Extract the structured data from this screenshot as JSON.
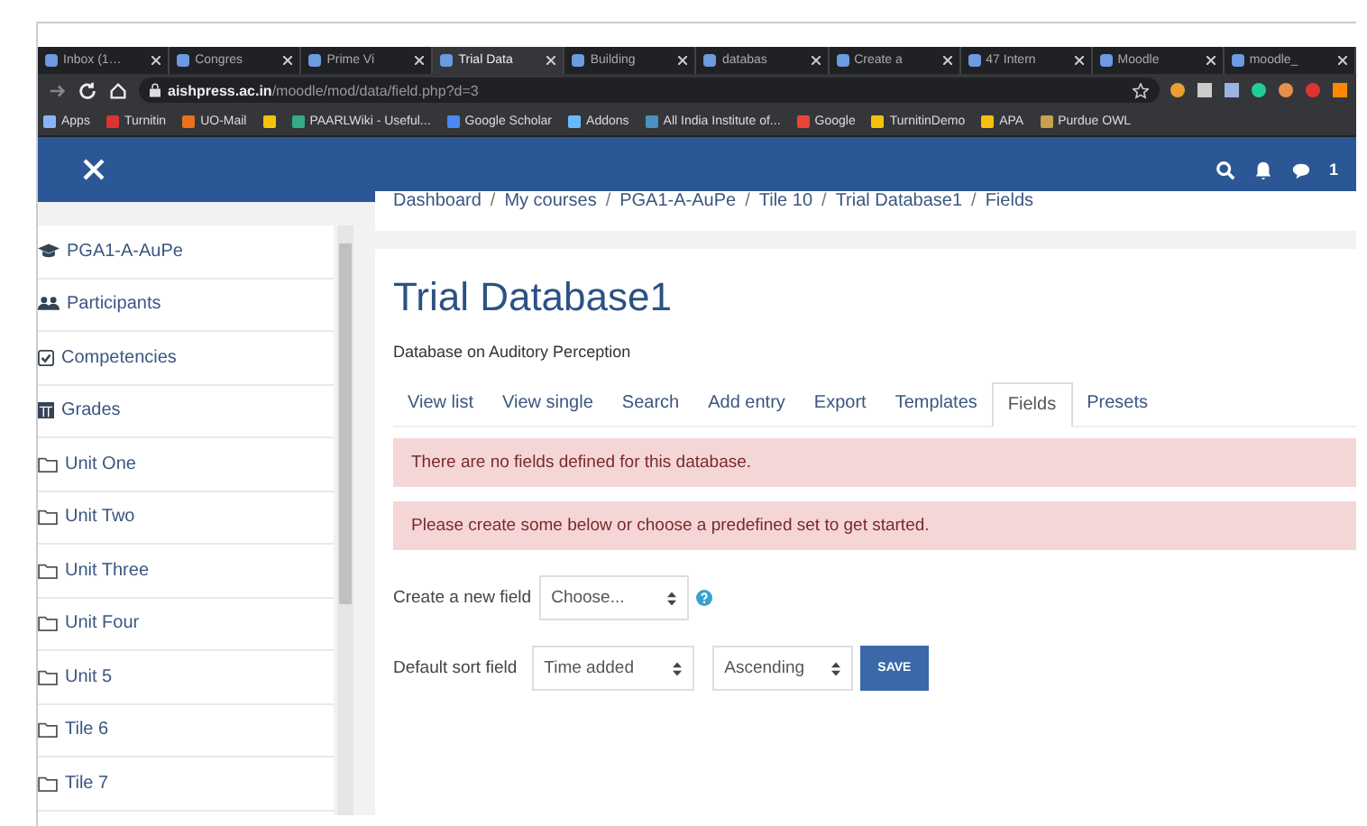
{
  "browser": {
    "tabs": [
      {
        "title": "Inbox (1…",
        "selected": false
      },
      {
        "title": "Congres",
        "selected": false
      },
      {
        "title": "Prime Vi",
        "selected": false
      },
      {
        "title": "Trial Data",
        "selected": true
      },
      {
        "title": "Building",
        "selected": false
      },
      {
        "title": "databas",
        "selected": false
      },
      {
        "title": "Create a",
        "selected": false
      },
      {
        "title": "47 Intern",
        "selected": false
      },
      {
        "title": "Moodle",
        "selected": false
      },
      {
        "title": "moodle_",
        "selected": false
      }
    ],
    "url_host": "aishpress.ac.in",
    "url_path": "/moodle/mod/data/field.php?d=3",
    "bookmarks": [
      {
        "kind": "link",
        "label": "Apps"
      },
      {
        "kind": "link",
        "label": "Turnitin"
      },
      {
        "kind": "link",
        "label": "UO-Mail"
      },
      {
        "kind": "icon"
      },
      {
        "kind": "link",
        "label": "PAARLWiki - Useful..."
      },
      {
        "kind": "link",
        "label": "Google Scholar"
      },
      {
        "kind": "link",
        "label": "Addons"
      },
      {
        "kind": "link",
        "label": "All India Institute of..."
      },
      {
        "kind": "link",
        "label": "Google"
      },
      {
        "kind": "link",
        "label": "TurnitinDemo"
      },
      {
        "kind": "link",
        "label": "APA"
      },
      {
        "kind": "link",
        "label": "Purdue OWL"
      }
    ]
  },
  "navbar": {
    "user_text": "1"
  },
  "sidebar": {
    "items": [
      {
        "label": "PGA1-A-AuPe",
        "kind": "course"
      },
      {
        "label": "Participants",
        "kind": "participants"
      },
      {
        "label": "Competencies",
        "kind": "competencies"
      },
      {
        "label": "Grades",
        "kind": "grades"
      },
      {
        "label": "Unit One",
        "kind": "section"
      },
      {
        "label": "Unit Two",
        "kind": "section"
      },
      {
        "label": "Unit Three",
        "kind": "section"
      },
      {
        "label": "Unit Four",
        "kind": "section"
      },
      {
        "label": "Unit 5",
        "kind": "section"
      },
      {
        "label": "Tile 6",
        "kind": "section"
      },
      {
        "label": "Tile 7",
        "kind": "section"
      }
    ]
  },
  "breadcrumb_separator": "/",
  "breadcrumb": [
    "Dashboard",
    "My courses",
    "PGA1-A-AuPe",
    "Tile 10",
    "Trial Database1",
    "Fields"
  ],
  "page": {
    "title": "Trial Database1",
    "description": "Database on Auditory Perception",
    "tabs": [
      {
        "label": "View list",
        "selected": false
      },
      {
        "label": "View single",
        "selected": false
      },
      {
        "label": "Search",
        "selected": false
      },
      {
        "label": "Add entry",
        "selected": false
      },
      {
        "label": "Export",
        "selected": false
      },
      {
        "label": "Templates",
        "selected": false
      },
      {
        "label": "Fields",
        "selected": true
      },
      {
        "label": "Presets",
        "selected": false
      }
    ],
    "alerts": [
      "There are no fields defined for this database.",
      "Please create some below or choose a predefined set to get started."
    ],
    "new_field": {
      "label": "Create a new field",
      "value": "Choose..."
    },
    "sort": {
      "label": "Default sort field",
      "field": "Time added",
      "order": "Ascending",
      "button": "SAVE"
    }
  }
}
